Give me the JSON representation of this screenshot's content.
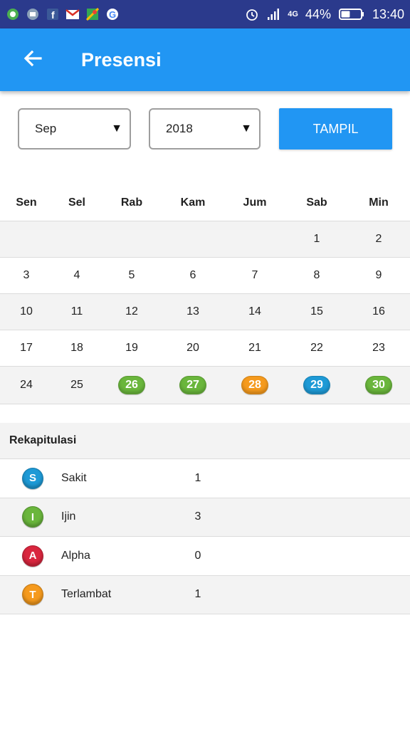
{
  "status_bar": {
    "battery": "44%",
    "network": "4G",
    "time": "13:40",
    "notification_icons": [
      "hangouts-icon",
      "gallery-icon",
      "facebook-icon",
      "gmail-icon",
      "maps-icon",
      "google-icon"
    ]
  },
  "app_bar": {
    "title": "Presensi",
    "color": "#2196f3"
  },
  "filters": {
    "month": "Sep",
    "year": "2018",
    "button_label": "TAMPIL"
  },
  "calendar": {
    "days": [
      "Sen",
      "Sel",
      "Rab",
      "Kam",
      "Jum",
      "Sab",
      "Min"
    ],
    "weeks": [
      [
        {
          "d": ""
        },
        {
          "d": ""
        },
        {
          "d": ""
        },
        {
          "d": ""
        },
        {
          "d": ""
        },
        {
          "d": "1"
        },
        {
          "d": "2"
        }
      ],
      [
        {
          "d": "3"
        },
        {
          "d": "4"
        },
        {
          "d": "5"
        },
        {
          "d": "6"
        },
        {
          "d": "7"
        },
        {
          "d": "8"
        },
        {
          "d": "9"
        }
      ],
      [
        {
          "d": "10"
        },
        {
          "d": "11"
        },
        {
          "d": "12"
        },
        {
          "d": "13"
        },
        {
          "d": "14"
        },
        {
          "d": "15"
        },
        {
          "d": "16"
        }
      ],
      [
        {
          "d": "17"
        },
        {
          "d": "18"
        },
        {
          "d": "19"
        },
        {
          "d": "20"
        },
        {
          "d": "21"
        },
        {
          "d": "22"
        },
        {
          "d": "23"
        }
      ],
      [
        {
          "d": "24"
        },
        {
          "d": "25"
        },
        {
          "d": "26",
          "status": "ijin"
        },
        {
          "d": "27",
          "status": "ijin"
        },
        {
          "d": "28",
          "status": "terlambat"
        },
        {
          "d": "29",
          "status": "sakit"
        },
        {
          "d": "30",
          "status": "ijin"
        }
      ]
    ]
  },
  "status_colors": {
    "sakit": "#1e9ad6",
    "ijin": "#6ab63c",
    "alpha": "#d9263e",
    "terlambat": "#f59a1d"
  },
  "recap": {
    "title": "Rekapitulasi",
    "items": [
      {
        "key": "sakit",
        "letter": "S",
        "label": "Sakit",
        "count": "1"
      },
      {
        "key": "ijin",
        "letter": "I",
        "label": "Ijin",
        "count": "3"
      },
      {
        "key": "alpha",
        "letter": "A",
        "label": "Alpha",
        "count": "0"
      },
      {
        "key": "terlambat",
        "letter": "T",
        "label": "Terlambat",
        "count": "1"
      }
    ]
  }
}
